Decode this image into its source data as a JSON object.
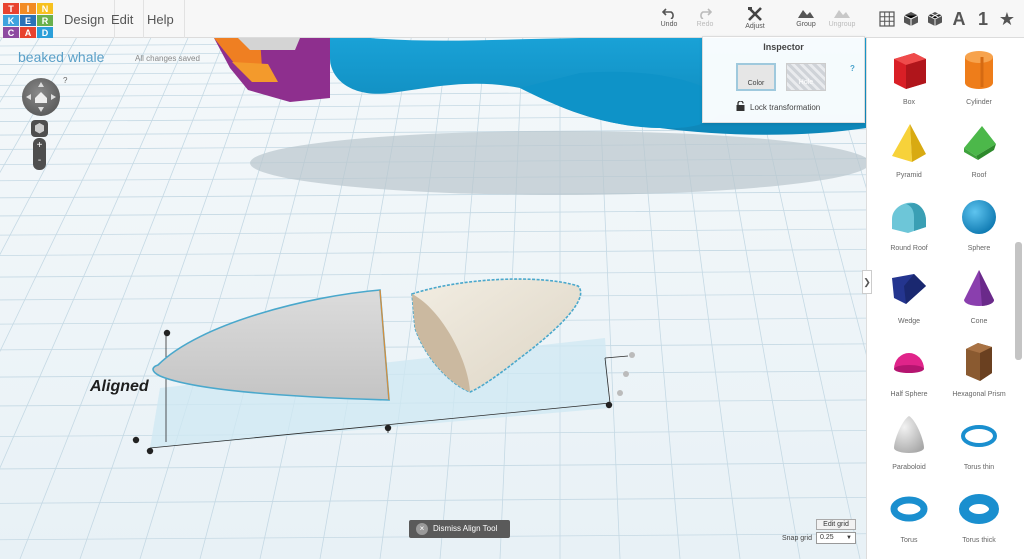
{
  "app": {
    "logo_letters": [
      "T",
      "I",
      "N",
      "K",
      "E",
      "R",
      "C",
      "A",
      "D"
    ],
    "logo_colors": [
      "#e8432f",
      "#f28b24",
      "#f7c11f",
      "#3fa3de",
      "#2b72b8",
      "#6ab04c",
      "#8e4aa0",
      "#e8432f",
      "#2b9fd9"
    ],
    "accent_color": "#5aa0c8"
  },
  "menu": {
    "design": "Design",
    "edit": "Edit",
    "help": "Help"
  },
  "toolbar": {
    "undo": "Undo",
    "redo": "Redo",
    "adjust": "Adjust",
    "group": "Group",
    "ungroup": "Ungroup",
    "right_icons": [
      "grid-view-icon",
      "box-view-icon",
      "multi-box-icon",
      "text-icon",
      "number-icon",
      "favorites-star-icon"
    ],
    "text_glyph": "A",
    "number_glyph": "1",
    "star_glyph": "★"
  },
  "design": {
    "title": "beaked whale",
    "save_status": "All changes saved",
    "help": "?"
  },
  "nav": {
    "zoom_in": "+",
    "zoom_out": "-"
  },
  "canvas": {
    "annotation": "Aligned"
  },
  "inspector": {
    "title": "Inspector",
    "color_label": "Color",
    "hole_label": "Hole",
    "help": "?",
    "lock_label": "Lock transformation"
  },
  "align": {
    "dismiss_label": "Dismiss Align Tool",
    "dismiss_icon": "×"
  },
  "grid": {
    "edit_label": "Edit grid",
    "snap_label": "Snap grid",
    "snap_value": "0.25"
  },
  "sidebar": {
    "toggle": "❯",
    "shapes": [
      {
        "label": "Box",
        "color": "#d91f26"
      },
      {
        "label": "Cylinder",
        "color": "#ee7d1a"
      },
      {
        "label": "Pyramid",
        "color": "#f0c419"
      },
      {
        "label": "Roof",
        "color": "#3a9e36"
      },
      {
        "label": "Round Roof",
        "color": "#5bbcd0"
      },
      {
        "label": "Sphere",
        "color": "#1a8fcf"
      },
      {
        "label": "Wedge",
        "color": "#1f2f8a"
      },
      {
        "label": "Cone",
        "color": "#7a2f9c"
      },
      {
        "label": "Half Sphere",
        "color": "#d6177f"
      },
      {
        "label": "Hexagonal Prism",
        "color": "#7a4a22"
      },
      {
        "label": "Paraboloid",
        "color": "#c8c8c8"
      },
      {
        "label": "Torus thin",
        "color": "#1a8fcf"
      },
      {
        "label": "Torus",
        "color": "#1a8fcf"
      },
      {
        "label": "Torus thick",
        "color": "#1a8fcf"
      }
    ]
  }
}
